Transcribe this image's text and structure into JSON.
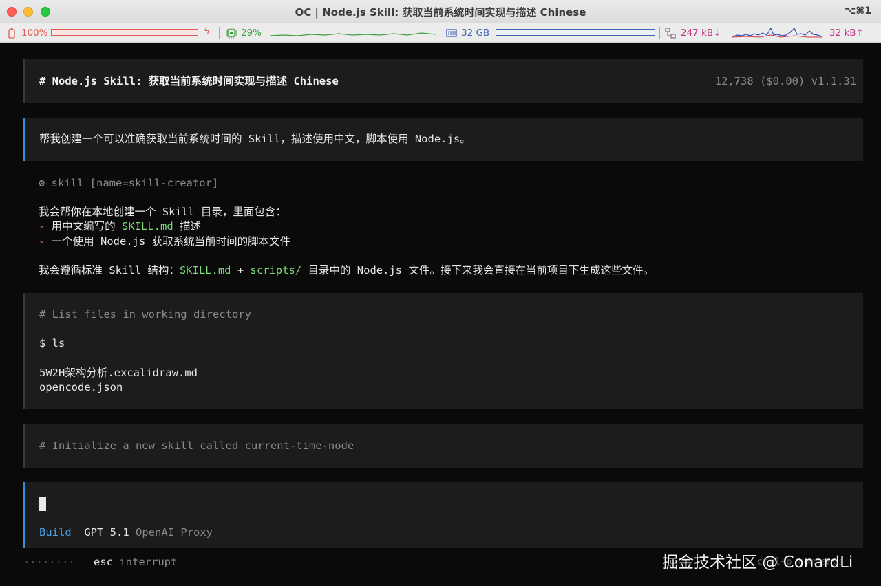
{
  "window": {
    "title": "OC | Node.js Skill: 获取当前系统时间实现与描述 Chinese",
    "shortcut": "⌥⌘1"
  },
  "status": {
    "battery": "100%",
    "battery_level": 1.0,
    "cpu": "29%",
    "memory": "32 GB",
    "net_down": "247 kB↓",
    "net_up": "32 kB↑",
    "colors": {
      "battery": "#e25b50",
      "cpu": "#3e9f42",
      "memory": "#3f63b5",
      "network": "#c03a8c",
      "net_up": "#d23c3c"
    }
  },
  "header": {
    "title": "# Node.js Skill: 获取当前系统时间实现与描述 Chinese",
    "meta": "12,738 ($0.00) v1.1.31"
  },
  "user_message": "帮我创建一个可以准确获取当前系统时间的 Skill，描述使用中文，脚本使用 Node.js。",
  "assistant": {
    "tool_icon": "gear-icon",
    "tool_line": "⚙ skill [name=skill-creator]",
    "intro": "我会帮你在本地创建一个 Skill 目录，里面包含：",
    "bullet_marker": "-",
    "bullet1_pre": " 用中文编写的 ",
    "bullet1_code": "SKILL.md",
    "bullet1_post": " 描述",
    "bullet2": " 一个使用 Node.js 获取系统当前时间的脚本文件",
    "line_pre": "我会遵循标准 Skill 结构：",
    "line_code1": "SKILL.md",
    "line_plus": " + ",
    "line_code2": "scripts/",
    "line_post": " 目录中的 Node.js 文件。接下来我会直接在当前项目下生成这些文件。"
  },
  "bash": {
    "comment": "# List files in working directory",
    "command": "$ ls",
    "output": [
      "5W2H架构分析.excalidraw.md",
      "opencode.json"
    ]
  },
  "pending": {
    "comment": "# Initialize a new skill called current-time-node"
  },
  "input": {
    "mode": "Build",
    "model": "GPT 5.1",
    "provider": "OpenAI Proxy"
  },
  "footer": {
    "spinner": "········",
    "key": "esc",
    "action": "interrupt",
    "watermark": "掘金技术社区 @ ConardLi",
    "right_hint": "ctrl+p commands"
  }
}
